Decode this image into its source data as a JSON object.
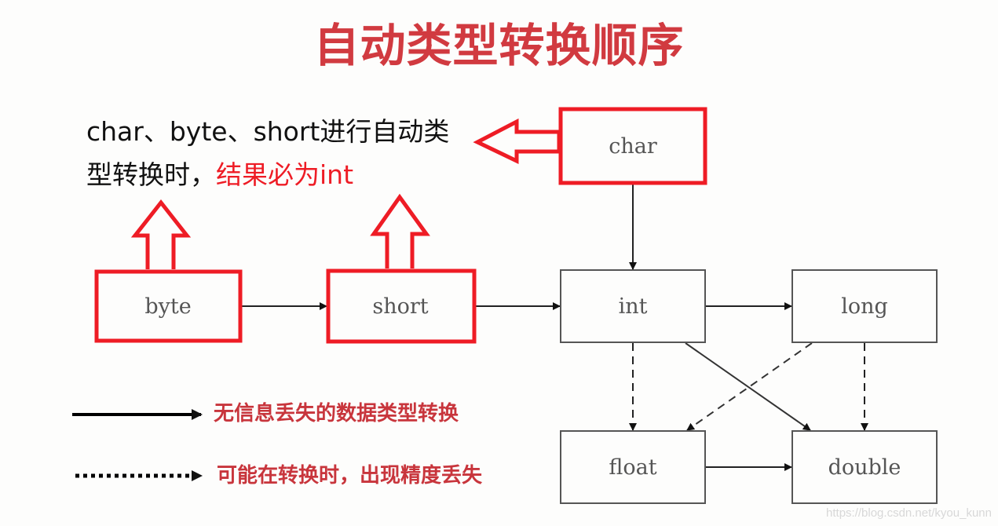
{
  "title": "自动类型转换顺序",
  "description": {
    "line1": "char、byte、short进行自动类",
    "line2_black": "型转换时，",
    "line2_red": "结果必为int"
  },
  "colors": {
    "title": "#d13a40",
    "highlight_red": "#ee1c25",
    "legend_text": "#c8353c",
    "box_border": "#555555"
  },
  "nodes": [
    {
      "id": "char",
      "label": "char",
      "highlighted": true
    },
    {
      "id": "byte",
      "label": "byte",
      "highlighted": true
    },
    {
      "id": "short",
      "label": "short",
      "highlighted": true
    },
    {
      "id": "int",
      "label": "int",
      "highlighted": false
    },
    {
      "id": "long",
      "label": "long",
      "highlighted": false
    },
    {
      "id": "float",
      "label": "float",
      "highlighted": false
    },
    {
      "id": "double",
      "label": "double",
      "highlighted": false
    }
  ],
  "edges": [
    {
      "from": "byte",
      "to": "short",
      "style": "solid"
    },
    {
      "from": "short",
      "to": "int",
      "style": "solid"
    },
    {
      "from": "char",
      "to": "int",
      "style": "solid"
    },
    {
      "from": "int",
      "to": "long",
      "style": "solid"
    },
    {
      "from": "int",
      "to": "float",
      "style": "dashed"
    },
    {
      "from": "int",
      "to": "double",
      "style": "solid"
    },
    {
      "from": "long",
      "to": "float",
      "style": "dashed"
    },
    {
      "from": "long",
      "to": "double",
      "style": "dashed"
    },
    {
      "from": "float",
      "to": "double",
      "style": "solid"
    }
  ],
  "legend": [
    {
      "style": "solid",
      "text": "无信息丢失的数据类型转换"
    },
    {
      "style": "dotted",
      "text": "可能在转换时，出现精度丢失"
    }
  ],
  "watermark": "https://blog.csdn.net/kyou_kunn"
}
